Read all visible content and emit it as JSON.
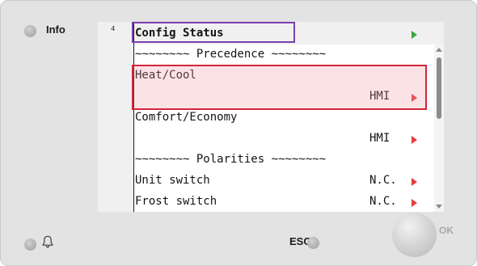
{
  "panel": {
    "info_label": "Info",
    "esc_label": "ESC",
    "ok_label": "OK"
  },
  "screen": {
    "line_number": "4",
    "title": "Config Status",
    "rows": [
      {
        "label": "~~~~~~~~ Precedence ~~~~~~~~",
        "value": "",
        "arrow": false
      },
      {
        "label": "Heat/Cool",
        "value": "",
        "arrow": false
      },
      {
        "label": "",
        "value": "HMI",
        "arrow": true
      },
      {
        "label": "Comfort/Economy",
        "value": "",
        "arrow": false
      },
      {
        "label": "",
        "value": "HMI",
        "arrow": true
      },
      {
        "label": "~~~~~~~~ Polarities ~~~~~~~~",
        "value": "",
        "arrow": false
      },
      {
        "label": "Unit switch",
        "value": "N.C.",
        "arrow": true
      },
      {
        "label": "Frost switch",
        "value": "N.C.",
        "arrow": true
      }
    ]
  },
  "icons": {
    "led": "status-led-icon",
    "bell": "bell-icon",
    "arrow_title": "green-right-arrow-icon",
    "arrow_value": "red-right-arrow-icon",
    "scroll_up": "scroll-up-icon",
    "scroll_down": "scroll-down-icon"
  },
  "colors": {
    "panel_bg": "#e3e3e3",
    "title_highlight": "#7b3fb0",
    "selection_border": "#d1263b",
    "arrow_red": "#e63b3b",
    "arrow_green": "#39a83b"
  }
}
